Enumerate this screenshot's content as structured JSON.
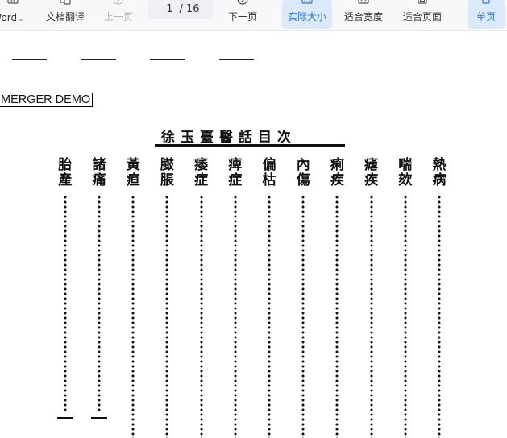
{
  "toolbar": {
    "word_label": "Word",
    "translate_label": "文档翻译",
    "prev_label": "上一页",
    "page_current": "1",
    "page_total": "/ 16",
    "next_label": "下一页",
    "actual_size_label": "实际大小",
    "fit_width_label": "适合宽度",
    "fit_page_label": "适合页面",
    "single_page_label": "单页"
  },
  "document": {
    "demo_label": "MERGER DEMO",
    "scan_title_chars": [
      "徐",
      "玉",
      "臺",
      "醫",
      "話",
      "目",
      "次"
    ],
    "toc_columns": [
      {
        "chars": [
          "熱",
          "病"
        ]
      },
      {
        "chars": [
          "喘",
          "欬"
        ]
      },
      {
        "chars": [
          "瘧",
          "疾"
        ]
      },
      {
        "chars": [
          "痢",
          "疾"
        ]
      },
      {
        "chars": [
          "內",
          "傷"
        ]
      },
      {
        "chars": [
          "偏",
          "枯"
        ]
      },
      {
        "chars": [
          "痺",
          "症"
        ]
      },
      {
        "chars": [
          "痿",
          "症"
        ]
      },
      {
        "chars": [
          "臌",
          "脹"
        ]
      },
      {
        "chars": [
          "黃",
          "疸"
        ]
      },
      {
        "chars": [
          "諸",
          "痛"
        ]
      },
      {
        "chars": [
          "胎",
          "產"
        ]
      }
    ]
  },
  "colors": {
    "accent": "#2b7cd3",
    "active_bg": "#dbe9fb",
    "toolbar_bg": "#f7f8fa"
  }
}
